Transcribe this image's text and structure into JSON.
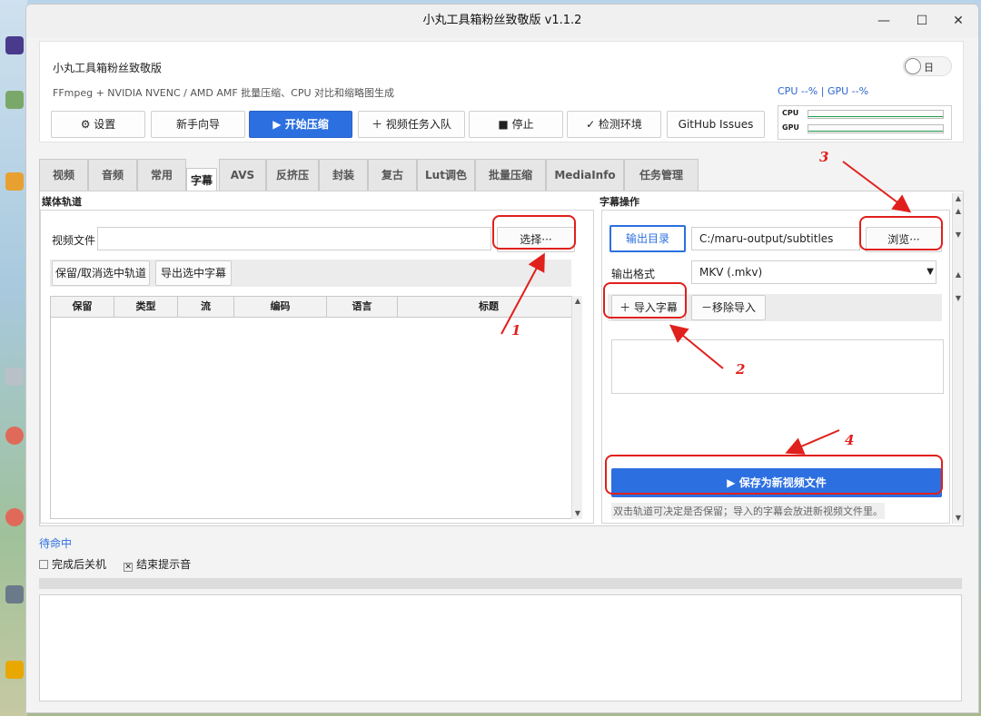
{
  "window": {
    "title": "小丸工具箱粉丝致敬版 v1.1.2",
    "minimize": "—",
    "maximize": "☐",
    "close": "✕"
  },
  "header": {
    "app_name": "小丸工具箱粉丝致敬版",
    "description": "FFmpeg + NVIDIA NVENC / AMD AMF 批量压缩、CPU 对比和缩略图生成",
    "theme_toggle_label": "日",
    "stats": "CPU --%  |  GPU --%",
    "cpu_label": "CPU",
    "gpu_label": "GPU"
  },
  "toolbar": {
    "settings": "⚙ 设置",
    "wizard": "新手向导",
    "start": "▶ 开始压缩",
    "add_queue": "＋ 视频任务入队",
    "stop": "■ 停止",
    "check_env": "✓ 检测环境",
    "github": "GitHub Issues"
  },
  "tabs": [
    "视频",
    "音频",
    "常用",
    "字幕",
    "AVS",
    "反挤压",
    "封装",
    "复古",
    "Lut调色",
    "批量压缩",
    "MediaInfo",
    "任务管理"
  ],
  "media_track": {
    "title": "媒体轨道",
    "video_file_label": "视频文件",
    "video_file_value": "",
    "choose_button": "选择···",
    "toggle_keep_button": "保留/取消选中轨道",
    "export_sub_button": "导出选中字幕",
    "columns": [
      "保留",
      "类型",
      "流",
      "编码",
      "语言",
      "标题"
    ]
  },
  "subtitle_ops": {
    "title": "字幕操作",
    "output_dir_button": "输出目录",
    "output_dir_value": "C:/maru-output/subtitles",
    "browse_button": "浏览···",
    "format_label": "输出格式",
    "format_value": "MKV (.mkv)",
    "import_button": "＋ 导入字幕",
    "remove_button": "－移除导入",
    "save_button": "▶ 保存为新视频文件",
    "hint": "双击轨道可决定是否保留；导入的字幕会放进新视频文件里。"
  },
  "status": {
    "text": "待命中",
    "shutdown_label": "完成后关机",
    "beep_label": "结束提示音"
  },
  "annotations": [
    "1",
    "2",
    "3",
    "4"
  ],
  "accent_color": "#2c6fe0",
  "annotation_color": "#e0201c"
}
